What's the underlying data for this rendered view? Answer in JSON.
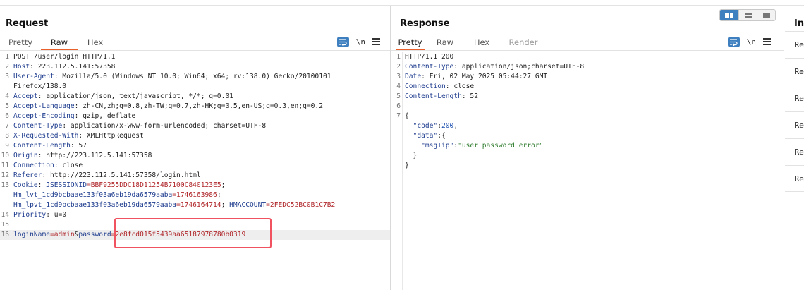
{
  "request": {
    "title": "Request",
    "tabs": [
      "Pretty",
      "Raw",
      "Hex"
    ],
    "active_tab": "Raw",
    "newline_label": "\\n",
    "lines": [
      {
        "n": "1",
        "parts": [
          {
            "t": "POST /user/login HTTP/1.1",
            "c": ""
          }
        ]
      },
      {
        "n": "2",
        "parts": [
          {
            "t": "Host",
            "c": "k"
          },
          {
            "t": ": 223.112.5.141:57358",
            "c": ""
          }
        ]
      },
      {
        "n": "3",
        "parts": [
          {
            "t": "User-Agent",
            "c": "k"
          },
          {
            "t": ": Mozilla/5.0 (Windows NT 10.0; Win64; x64; rv:138.0) Gecko/20100101",
            "c": ""
          }
        ]
      },
      {
        "n": "",
        "parts": [
          {
            "t": "Firefox/138.0",
            "c": ""
          }
        ]
      },
      {
        "n": "4",
        "parts": [
          {
            "t": "Accept",
            "c": "k"
          },
          {
            "t": ": application/json, text/javascript, */*; q=0.01",
            "c": ""
          }
        ]
      },
      {
        "n": "5",
        "parts": [
          {
            "t": "Accept-Language",
            "c": "k"
          },
          {
            "t": ": zh-CN,zh;q=0.8,zh-TW;q=0.7,zh-HK;q=0.5,en-US;q=0.3,en;q=0.2",
            "c": ""
          }
        ]
      },
      {
        "n": "6",
        "parts": [
          {
            "t": "Accept-Encoding",
            "c": "k"
          },
          {
            "t": ": gzip, deflate",
            "c": ""
          }
        ]
      },
      {
        "n": "7",
        "parts": [
          {
            "t": "Content-Type",
            "c": "k"
          },
          {
            "t": ": application/x-www-form-urlencoded; charset=UTF-8",
            "c": ""
          }
        ]
      },
      {
        "n": "8",
        "parts": [
          {
            "t": "X-Requested-With",
            "c": "k"
          },
          {
            "t": ": XMLHttpRequest",
            "c": ""
          }
        ]
      },
      {
        "n": "9",
        "parts": [
          {
            "t": "Content-Length",
            "c": "k"
          },
          {
            "t": ": 57",
            "c": ""
          }
        ]
      },
      {
        "n": "10",
        "parts": [
          {
            "t": "Origin",
            "c": "k"
          },
          {
            "t": ": http://223.112.5.141:57358",
            "c": ""
          }
        ]
      },
      {
        "n": "11",
        "parts": [
          {
            "t": "Connection",
            "c": "k"
          },
          {
            "t": ": close",
            "c": ""
          }
        ]
      },
      {
        "n": "12",
        "parts": [
          {
            "t": "Referer",
            "c": "k"
          },
          {
            "t": ": http://223.112.5.141:57358/login.html",
            "c": ""
          }
        ]
      },
      {
        "n": "13",
        "parts": [
          {
            "t": "Cookie",
            "c": "k"
          },
          {
            "t": ": ",
            "c": ""
          },
          {
            "t": "JSESSIONID",
            "c": "cookiek"
          },
          {
            "t": "=BBF9255DDC18D11254B7100C840123E5",
            "c": "cookiev"
          },
          {
            "t": ";",
            "c": ""
          }
        ]
      },
      {
        "n": "",
        "parts": [
          {
            "t": "Hm_lvt_1cd9bcbaae133f03a6eb19da6579aaba",
            "c": "cookiek"
          },
          {
            "t": "=1746163986",
            "c": "cookiev"
          },
          {
            "t": ";",
            "c": ""
          }
        ]
      },
      {
        "n": "",
        "parts": [
          {
            "t": "Hm_lpvt_1cd9bcbaae133f03a6eb19da6579aaba",
            "c": "cookiek"
          },
          {
            "t": "=1746164714",
            "c": "cookiev"
          },
          {
            "t": "; ",
            "c": ""
          },
          {
            "t": "HMACCOUNT",
            "c": "cookiek"
          },
          {
            "t": "=2FEDC52BC0B1C7B2",
            "c": "cookiev"
          }
        ]
      },
      {
        "n": "14",
        "parts": [
          {
            "t": "Priority",
            "c": "k"
          },
          {
            "t": ": u=0",
            "c": ""
          }
        ]
      },
      {
        "n": "15",
        "parts": []
      },
      {
        "n": "16",
        "parts": [
          {
            "t": "loginName",
            "c": "cookiek"
          },
          {
            "t": "=admin",
            "c": "cookiev"
          },
          {
            "t": "&",
            "c": ""
          },
          {
            "t": "password",
            "c": "cookiek"
          },
          {
            "t": "=2e8fcd015f5439aa65187978780b0319",
            "c": "cookiev"
          }
        ],
        "highlight": true
      }
    ]
  },
  "response": {
    "title": "Response",
    "tabs": [
      "Pretty",
      "Raw",
      "Hex",
      "Render"
    ],
    "active_tab": "Pretty",
    "newline_label": "\\n",
    "lines": [
      {
        "n": "1",
        "parts": [
          {
            "t": "HTTP/1.1 200",
            "c": ""
          }
        ]
      },
      {
        "n": "2",
        "parts": [
          {
            "t": "Content-Type",
            "c": "k"
          },
          {
            "t": ": application/json;charset=UTF-8",
            "c": ""
          }
        ]
      },
      {
        "n": "3",
        "parts": [
          {
            "t": "Date",
            "c": "k"
          },
          {
            "t": ": Fri, 02 May 2025 05:44:27 GMT",
            "c": ""
          }
        ]
      },
      {
        "n": "4",
        "parts": [
          {
            "t": "Connection",
            "c": "k"
          },
          {
            "t": ": close",
            "c": ""
          }
        ]
      },
      {
        "n": "5",
        "parts": [
          {
            "t": "Content-Length",
            "c": "k"
          },
          {
            "t": ": 52",
            "c": ""
          }
        ]
      },
      {
        "n": "6",
        "parts": []
      },
      {
        "n": "7",
        "parts": [
          {
            "t": "{",
            "c": ""
          }
        ]
      },
      {
        "n": "",
        "parts": [
          {
            "t": "  \"code\"",
            "c": "k"
          },
          {
            "t": ":",
            "c": ""
          },
          {
            "t": "200",
            "c": "num"
          },
          {
            "t": ",",
            "c": ""
          }
        ]
      },
      {
        "n": "",
        "parts": [
          {
            "t": "  \"data\"",
            "c": "k"
          },
          {
            "t": ":{",
            "c": ""
          }
        ]
      },
      {
        "n": "",
        "parts": [
          {
            "t": "    \"msgTip\"",
            "c": "k"
          },
          {
            "t": ":",
            "c": ""
          },
          {
            "t": "\"user password error\"",
            "c": "str"
          }
        ]
      },
      {
        "n": "",
        "parts": [
          {
            "t": "  }",
            "c": ""
          }
        ]
      },
      {
        "n": "",
        "parts": [
          {
            "t": "}",
            "c": ""
          }
        ]
      }
    ]
  },
  "inspector": {
    "title": "Inspector",
    "rows": [
      "Re",
      "Re",
      "Re",
      "Re",
      "Re",
      "Re"
    ]
  },
  "colors": {
    "accent": "#e8612c",
    "highlight_box": "#f05260",
    "button_blue": "#3d7fbf"
  }
}
